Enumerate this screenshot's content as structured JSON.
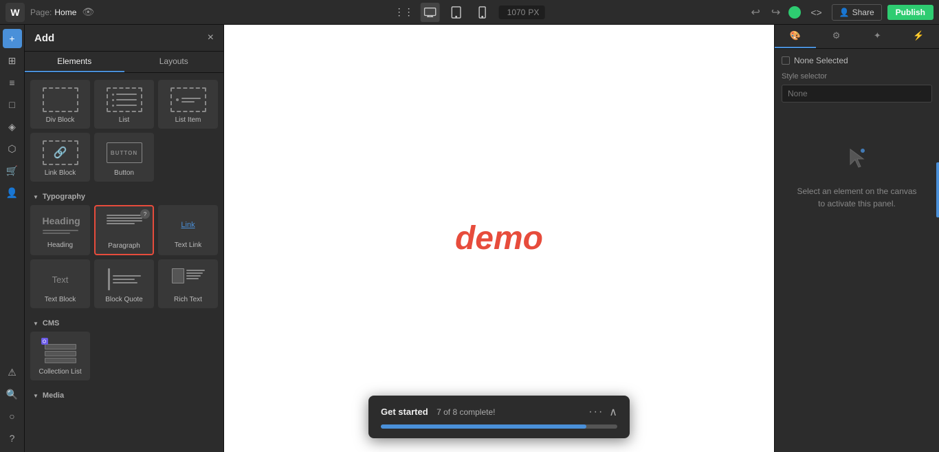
{
  "topbar": {
    "logo": "W",
    "page_label": "Page:",
    "page_name": "Home",
    "dimension": "1070",
    "dimension_unit": "PX",
    "undo_label": "↩",
    "redo_label": "↪",
    "share_label": "Share",
    "publish_label": "Publish"
  },
  "add_panel": {
    "title": "Add",
    "close_label": "×",
    "tab_elements": "Elements",
    "tab_layouts": "Layouts",
    "sections": [
      {
        "name": "basic",
        "items": [
          {
            "id": "div-block",
            "label": "Div Block"
          },
          {
            "id": "list",
            "label": "List"
          },
          {
            "id": "list-item",
            "label": "List Item"
          },
          {
            "id": "link-block",
            "label": "Link Block"
          },
          {
            "id": "button",
            "label": "Button"
          }
        ]
      },
      {
        "name": "typography",
        "label": "Typography",
        "items": [
          {
            "id": "heading",
            "label": "Heading"
          },
          {
            "id": "paragraph",
            "label": "Paragraph"
          },
          {
            "id": "text-link",
            "label": "Text Link"
          },
          {
            "id": "text-block",
            "label": "Text Block"
          },
          {
            "id": "block-quote",
            "label": "Block Quote"
          },
          {
            "id": "rich-text",
            "label": "Rich Text"
          }
        ]
      },
      {
        "name": "cms",
        "label": "CMS",
        "items": [
          {
            "id": "collection-list",
            "label": "Collection List"
          }
        ]
      },
      {
        "name": "media",
        "label": "Media"
      }
    ]
  },
  "canvas": {
    "demo_text": "demo"
  },
  "right_panel": {
    "tabs": [
      {
        "id": "style",
        "icon": "🎨"
      },
      {
        "id": "settings",
        "icon": "⚙"
      },
      {
        "id": "effects",
        "icon": "✦"
      },
      {
        "id": "interactions",
        "icon": "⚡"
      }
    ],
    "none_selected_label": "None Selected",
    "style_selector_label": "Style selector",
    "style_selector_placeholder": "None",
    "empty_state_text": "Select an element on the canvas to activate this panel."
  },
  "get_started": {
    "title": "Get started",
    "progress_text": "7 of 8 complete!",
    "progress_value": 87,
    "more_label": "···",
    "collapse_label": "∧"
  },
  "icons": {
    "left_sidebar": [
      {
        "id": "add",
        "symbol": "+"
      },
      {
        "id": "pages",
        "symbol": "⊞"
      },
      {
        "id": "layers",
        "symbol": "≡"
      },
      {
        "id": "assets",
        "symbol": "□"
      },
      {
        "id": "components",
        "symbol": "◈"
      },
      {
        "id": "cms-icon",
        "symbol": "⬡"
      },
      {
        "id": "ecommerce",
        "symbol": "🛒"
      },
      {
        "id": "users",
        "symbol": "👤"
      },
      {
        "id": "logic",
        "symbol": "△"
      },
      {
        "id": "search",
        "symbol": "🔍"
      },
      {
        "id": "profile",
        "symbol": "○"
      },
      {
        "id": "help",
        "symbol": "?"
      }
    ]
  }
}
